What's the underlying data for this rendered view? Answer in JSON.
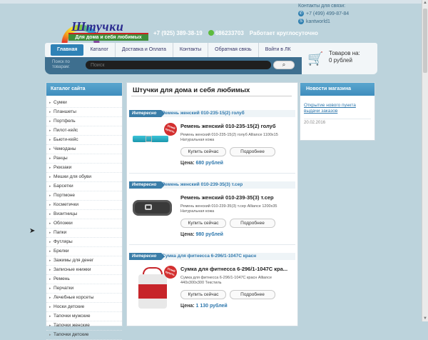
{
  "header": {
    "brand": "Штучки",
    "tagline": "Для дома и себя любимых",
    "contacts_title": "Контакты для связи:",
    "phone": "+7 (499) 499-87-84",
    "skype": "kantworld1",
    "phone_mobile": "+7 (925) 389-38-19",
    "icq": "686233703",
    "hours": "Работает круглосуточно"
  },
  "nav": {
    "items": [
      "Главная",
      "Каталог",
      "Доставка и Оплата",
      "Контакты",
      "Обратная связь",
      "Войти в ЛК"
    ]
  },
  "search": {
    "label": "Поиск по товарам:",
    "placeholder": "Поиск",
    "button_icon": "search-icon"
  },
  "cart": {
    "title": "Товаров на:",
    "amount": "0 рублей"
  },
  "sidebar": {
    "title": "Каталог сайта",
    "items": [
      "Сумки",
      "Планшеты",
      "Портфель",
      "Пилот-кейс",
      "Бьюти-кейс",
      "Чемоданы",
      "Ранцы",
      "Рюкзаки",
      "Мешки для обуви",
      "Барсетки",
      "Портмоне",
      "Косметички",
      "Визитницы",
      "Обложки",
      "Папки",
      "Футляры",
      "Брелки",
      "Зажимы для денег",
      "Записные книжки",
      "Ремень",
      "Перчатки",
      "Лечебные корсеты",
      "Носки детские",
      "Тапочки мужские",
      "Тапочки женские",
      "Тапочки детские"
    ]
  },
  "main": {
    "title": "Штучки для дома и себя любимых",
    "badge": "Интересно",
    "buy_label": "Купить сейчас",
    "details_label": "Подробнее",
    "price_label": "Цена:",
    "sale_label": "Успей купить",
    "products": [
      {
        "link": "Ремень женский 010-235-15(2) голуб",
        "name": "Ремень женский 010-235-15(2) голуб",
        "desc": "Ремень женский 010-235-15(2) голуб Alliance 1100x15 Натуральная кожа",
        "price": "680 рублей"
      },
      {
        "link": "Ремень женский 010-239-35(3) т.сер",
        "name": "Ремень женский 010-239-35(3) т.сер",
        "desc": "Ремень женский 010-239-35(3) т.сер Alliance 1200x35 Натуральная кожа",
        "price": "980 рублей"
      },
      {
        "link": "Сумка для фитнесса 6-296/1-1047С красн",
        "name": "Сумка для фитнесса 6-296/1-1047С кра...",
        "desc": "Сумка для фитнесса 6-296/1-1047С красн Alliance 440x300x300 Текстиль",
        "price": "1 130 рублей"
      }
    ]
  },
  "news": {
    "title": "Новости магазина",
    "item": "Открытие нового пункта выдачи заказов",
    "date": "20.02.2016"
  }
}
